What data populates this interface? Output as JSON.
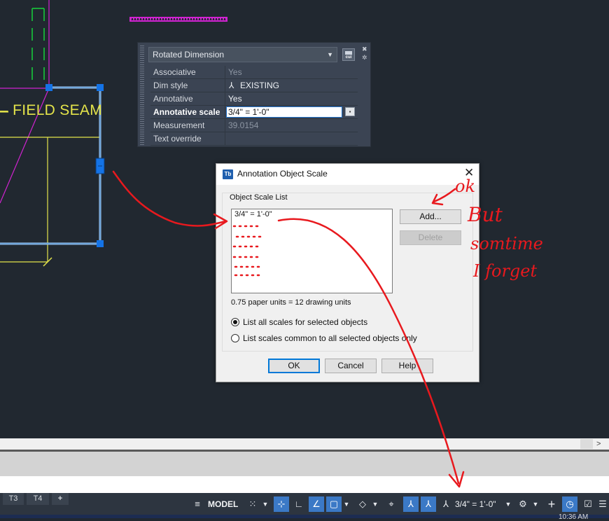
{
  "drawing": {
    "field_seam_label": "FIELD SEAM",
    "colors": {
      "yellow": "#e4e44a",
      "magenta": "#d023d0",
      "green": "#17d13b",
      "grip": "#1473e6"
    }
  },
  "properties": {
    "selector": "Rotated Dimension",
    "cui_label": "cui",
    "rows": [
      {
        "key": "Associative",
        "value": "Yes"
      },
      {
        "key": "Dim style",
        "value": "EXISTING"
      },
      {
        "key": "Annotative",
        "value": "Yes"
      },
      {
        "key": "Annotative scale",
        "value": "3/4\" = 1'-0\""
      },
      {
        "key": "Measurement",
        "value": "39.0154"
      },
      {
        "key": "Text override",
        "value": ""
      }
    ]
  },
  "dialog": {
    "icon_text": "Tb",
    "title": "Annotation Object Scale",
    "group_label": "Object Scale List",
    "scale_list": [
      "3/4\" = 1'-0\""
    ],
    "add_label": "Add...",
    "delete_label": "Delete",
    "units_text": "0.75 paper units = 12 drawing units",
    "radio_all": "List all scales for selected objects",
    "radio_common": "List scales common to all selected objects only",
    "radio_selected": "all",
    "ok_label": "OK",
    "cancel_label": "Cancel",
    "help_label": "Help"
  },
  "status_bar": {
    "layout_tabs": [
      "T3",
      "T4"
    ],
    "add_tab": "+",
    "model_label": "MODEL",
    "annotation_scale": "3/4\" = 1'-0\"",
    "clock": "10:36 AM"
  },
  "annotations": {
    "ok": "ok",
    "line1": "But",
    "line2": "somtime",
    "line3": "I forget",
    "ink_color": "#e8191e"
  }
}
